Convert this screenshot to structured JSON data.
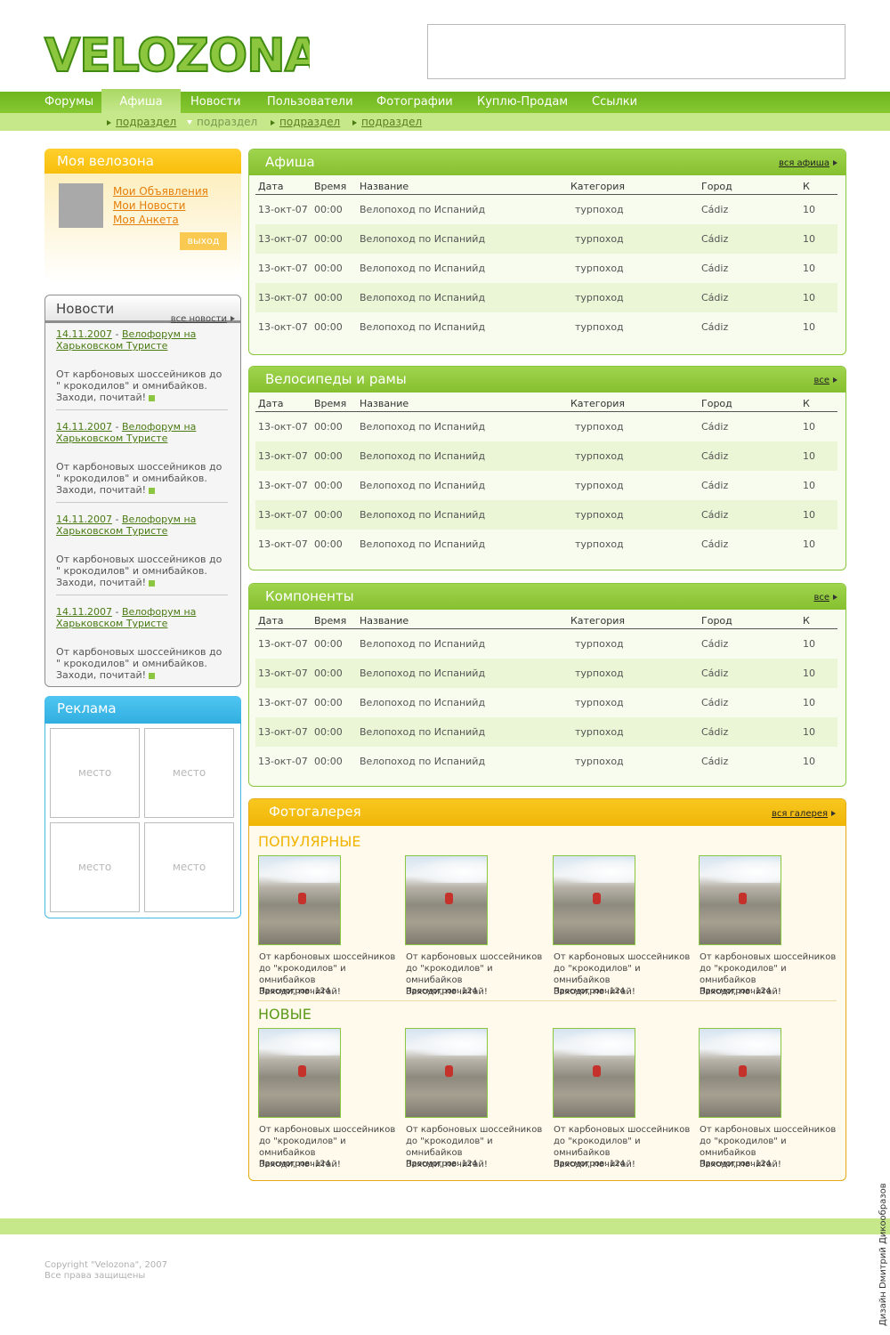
{
  "logo_text": "VELOZONA",
  "nav": {
    "items": [
      {
        "label": "Форумы"
      },
      {
        "label": "Афиша"
      },
      {
        "label": "Новости"
      },
      {
        "label": "Пользователи"
      },
      {
        "label": "Фотографии"
      },
      {
        "label": "Куплю-Продам"
      },
      {
        "label": "Ссылки"
      }
    ],
    "active_index": 1,
    "subitems": [
      "подраздел",
      "подраздел",
      "подраздел",
      "подраздел"
    ]
  },
  "my_zone": {
    "title": "Моя велозона",
    "links": [
      "Мои Объявления",
      "Мои Новости",
      "Моя Анкета"
    ],
    "exit_label": "выход"
  },
  "news": {
    "title": "Новости",
    "all_label": "все новости",
    "items": [
      {
        "date": "14.11.2007",
        "title_line1": "Велофорум на",
        "title_line2": "Харьковском Туристе",
        "body": "От карбоновых шоссейников до \" крокодилов\" и омнибайков. Заходи, почитай!"
      },
      {
        "date": "14.11.2007",
        "title_line1": "Велофорум на",
        "title_line2": "Харьковском Туристе",
        "body": "От карбоновых шоссейников до \" крокодилов\" и омнибайков. Заходи, почитай!"
      },
      {
        "date": "14.11.2007",
        "title_line1": "Велофорум на",
        "title_line2": "Харьковском Туристе",
        "body": "От карбоновых шоссейников до \" крокодилов\" и омнибайков. Заходи, почитай!"
      },
      {
        "date": "14.11.2007",
        "title_line1": "Велофорум на",
        "title_line2": "Харьковском Туристе",
        "body": "От карбоновых шоссейников до \" крокодилов\" и омнибайков. Заходи, почитай!"
      }
    ]
  },
  "ads": {
    "title": "Реклама",
    "slots": [
      "место",
      "место",
      "место",
      "место"
    ]
  },
  "sections": [
    {
      "title": "Афиша",
      "all_label": "вся афиша",
      "columns": [
        "Дата",
        "Время",
        "Название",
        "Категория",
        "Город",
        "К"
      ],
      "rows": [
        [
          "13-окт-07",
          "00:00",
          "Велопоход по Испанийд",
          "турпоход",
          "Cádiz",
          "10"
        ],
        [
          "13-окт-07",
          "00:00",
          "Велопоход по Испанийд",
          "турпоход",
          "Cádiz",
          "10"
        ],
        [
          "13-окт-07",
          "00:00",
          "Велопоход по Испанийд",
          "турпоход",
          "Cádiz",
          "10"
        ],
        [
          "13-окт-07",
          "00:00",
          "Велопоход по Испанийд",
          "турпоход",
          "Cádiz",
          "10"
        ],
        [
          "13-окт-07",
          "00:00",
          "Велопоход по Испанийд",
          "турпоход",
          "Cádiz",
          "10"
        ]
      ]
    },
    {
      "title": "Велосипеды и рамы",
      "all_label": "все",
      "columns": [
        "Дата",
        "Время",
        "Название",
        "Категория",
        "Город",
        "К"
      ],
      "rows": [
        [
          "13-окт-07",
          "00:00",
          "Велопоход по Испанийд",
          "турпоход",
          "Cádiz",
          "10"
        ],
        [
          "13-окт-07",
          "00:00",
          "Велопоход по Испанийд",
          "турпоход",
          "Cádiz",
          "10"
        ],
        [
          "13-окт-07",
          "00:00",
          "Велопоход по Испанийд",
          "турпоход",
          "Cádiz",
          "10"
        ],
        [
          "13-окт-07",
          "00:00",
          "Велопоход по Испанийд",
          "турпоход",
          "Cádiz",
          "10"
        ],
        [
          "13-окт-07",
          "00:00",
          "Велопоход по Испанийд",
          "турпоход",
          "Cádiz",
          "10"
        ]
      ]
    },
    {
      "title": "Компоненты",
      "all_label": "все",
      "columns": [
        "Дата",
        "Время",
        "Название",
        "Категория",
        "Город",
        "К"
      ],
      "rows": [
        [
          "13-окт-07",
          "00:00",
          "Велопоход по Испанийд",
          "турпоход",
          "Cádiz",
          "10"
        ],
        [
          "13-окт-07",
          "00:00",
          "Велопоход по Испанийд",
          "турпоход",
          "Cádiz",
          "10"
        ],
        [
          "13-окт-07",
          "00:00",
          "Велопоход по Испанийд",
          "турпоход",
          "Cádiz",
          "10"
        ],
        [
          "13-окт-07",
          "00:00",
          "Велопоход по Испанийд",
          "турпоход",
          "Cádiz",
          "10"
        ],
        [
          "13-окт-07",
          "00:00",
          "Велопоход по Испанийд",
          "турпоход",
          "Cádiz",
          "10"
        ]
      ]
    }
  ],
  "gallery": {
    "title": "Фотогалерея",
    "all_label": "вся галерея",
    "popular_label": "ПОПУЛЯРНЫЕ",
    "new_label": "НОВЫЕ",
    "caption_line1": "От карбоновых шоссейников",
    "caption_line2": "до \"крокодилов\" и омнибайков",
    "caption_line3": "Заходи, почитай!",
    "views_label": "Просмотров: 124"
  },
  "footer": {
    "copyright": "Copyright \"Velozona\", 2007",
    "rights": "Все права защищены",
    "credit": "Дизайн Dмитрий Дикообразов"
  },
  "colors": {
    "green": "#8cc63f",
    "light_green": "#c6e88b",
    "yellow": "#f8be0a",
    "blue": "#47b6e3",
    "orange_link": "#e67e0a"
  }
}
